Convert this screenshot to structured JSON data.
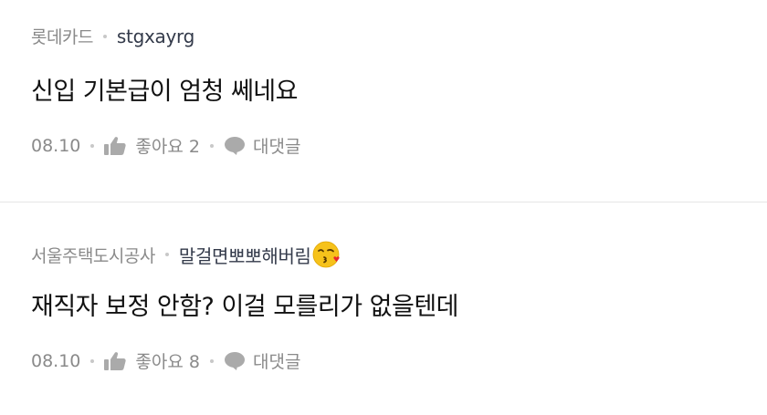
{
  "comments": [
    {
      "company": "롯데카드",
      "author": "stgxayrg",
      "text": "신입 기본급이 엄청 쎄네요",
      "date": "08.10",
      "likes_label": "좋아요 2",
      "reply_label": "대댓글"
    },
    {
      "company": "서울주택도시공사",
      "author": "말걸면뽀뽀해버림",
      "author_emoji": "kissing-face-emoji",
      "text": "재직자 보정 안함? 이걸 모를리가 없을텐데",
      "date": "08.10",
      "likes_label": "좋아요 8",
      "reply_label": "대댓글"
    }
  ],
  "icons": {
    "like": "thumbs-up-icon",
    "reply": "speech-bubble-icon"
  },
  "colors": {
    "meta": "#8a8a8a",
    "author": "#333a4a",
    "text": "#111111",
    "divider": "#e6e6e6",
    "icon": "#aaaaaa"
  }
}
